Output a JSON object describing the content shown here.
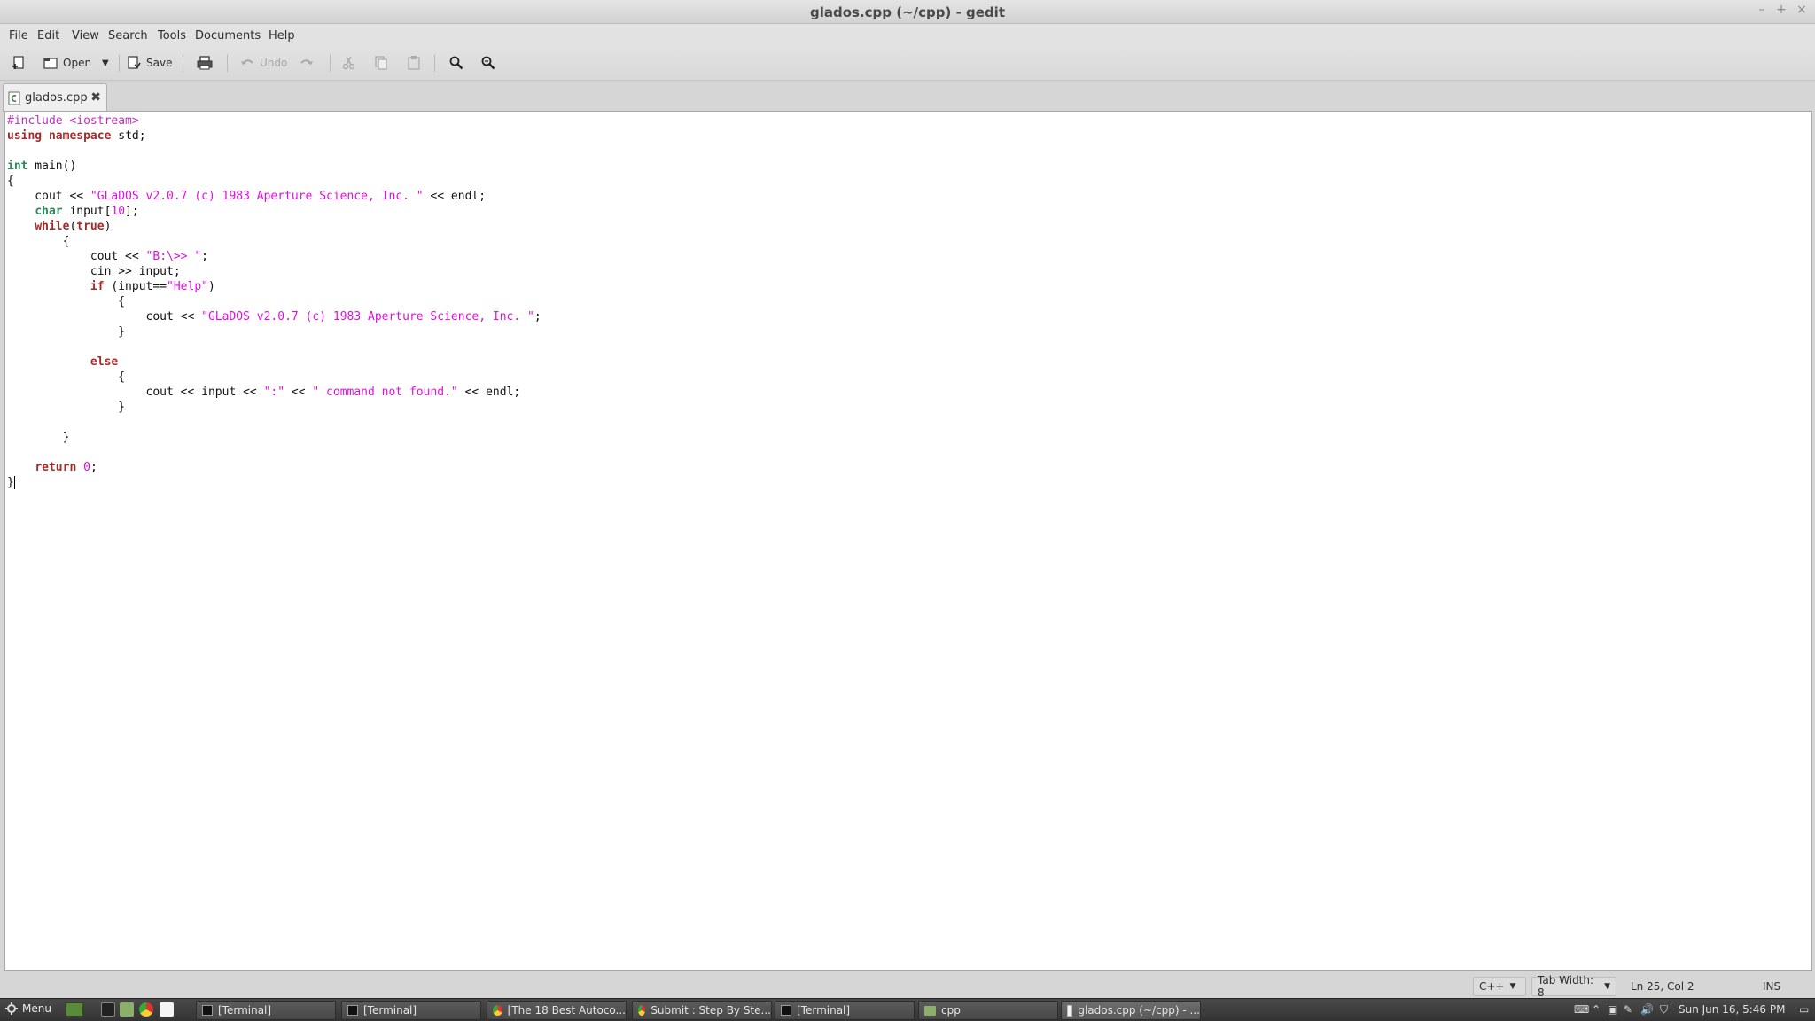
{
  "window": {
    "title": "glados.cpp (~/cpp) - gedit",
    "controls": [
      "–",
      "+",
      "×"
    ]
  },
  "menubar": [
    "File",
    "Edit",
    "View",
    "Search",
    "Tools",
    "Documents",
    "Help"
  ],
  "toolbar": {
    "open_label": "Open",
    "save_label": "Save",
    "undo_label": "Undo",
    "dropdown_glyph": "▼"
  },
  "tab": {
    "label": "glados.cpp",
    "close_glyph": "✖"
  },
  "editor": {
    "lines": [
      [
        {
          "t": "#include <iostream>",
          "c": "pp"
        }
      ],
      [
        {
          "t": "using",
          "c": "kw"
        },
        {
          "t": " "
        },
        {
          "t": "namespace",
          "c": "kw"
        },
        {
          "t": " std;"
        }
      ],
      [],
      [
        {
          "t": "int",
          "c": "ty"
        },
        {
          "t": " main()"
        }
      ],
      [
        {
          "t": "{"
        }
      ],
      [
        {
          "t": "    cout << "
        },
        {
          "t": "\"GLaDOS v2.0.7 (c) 1983 Aperture Science, Inc. \"",
          "c": "st"
        },
        {
          "t": " << endl;"
        }
      ],
      [
        {
          "t": "    "
        },
        {
          "t": "char",
          "c": "ty"
        },
        {
          "t": " input["
        },
        {
          "t": "10",
          "c": "nu"
        },
        {
          "t": "];"
        }
      ],
      [
        {
          "t": "    "
        },
        {
          "t": "while",
          "c": "kw"
        },
        {
          "t": "("
        },
        {
          "t": "true",
          "c": "kw"
        },
        {
          "t": ")"
        }
      ],
      [
        {
          "t": "        {"
        }
      ],
      [
        {
          "t": "            cout << "
        },
        {
          "t": "\"B:\\>> \"",
          "c": "st"
        },
        {
          "t": ";"
        }
      ],
      [
        {
          "t": "            cin >> input;"
        }
      ],
      [
        {
          "t": "            "
        },
        {
          "t": "if",
          "c": "kw"
        },
        {
          "t": " (input=="
        },
        {
          "t": "\"Help\"",
          "c": "st"
        },
        {
          "t": ")"
        }
      ],
      [
        {
          "t": "                {"
        }
      ],
      [
        {
          "t": "                    cout << "
        },
        {
          "t": "\"GLaDOS v2.0.7 (c) 1983 Aperture Science, Inc. \"",
          "c": "st"
        },
        {
          "t": ";"
        }
      ],
      [
        {
          "t": "                }"
        }
      ],
      [],
      [
        {
          "t": "            "
        },
        {
          "t": "else",
          "c": "kw"
        }
      ],
      [
        {
          "t": "                {"
        }
      ],
      [
        {
          "t": "                    cout << input << "
        },
        {
          "t": "\":\"",
          "c": "st"
        },
        {
          "t": " << "
        },
        {
          "t": "\" command not found.\"",
          "c": "st"
        },
        {
          "t": " << endl;"
        }
      ],
      [
        {
          "t": "                }"
        }
      ],
      [],
      [
        {
          "t": "        }"
        }
      ],
      [],
      [
        {
          "t": "    "
        },
        {
          "t": "return",
          "c": "kw"
        },
        {
          "t": " "
        },
        {
          "t": "0",
          "c": "nu"
        },
        {
          "t": ";"
        }
      ],
      [
        {
          "t": "}"
        }
      ]
    ]
  },
  "statusbar": {
    "language": "C++",
    "tab_width": "Tab Width: 8",
    "position": "Ln 25, Col 2",
    "mode": "INS",
    "dropdown_glyph": "▼"
  },
  "taskbar": {
    "menu_label": "Menu",
    "tasks": [
      {
        "label": "[Terminal]",
        "icon": "terminal-icon"
      },
      {
        "label": "[Terminal]",
        "icon": "terminal-icon"
      },
      {
        "label": "[The 18 Best Autoco...",
        "icon": "chrome-icon"
      },
      {
        "label": "Submit : Step By Ste...",
        "icon": "chrome-icon"
      },
      {
        "label": "[Terminal]",
        "icon": "terminal-icon"
      },
      {
        "label": "cpp",
        "icon": "folder-icon"
      },
      {
        "label": "glados.cpp (~/cpp) - ...",
        "icon": "text-editor-icon"
      }
    ],
    "clock": "Sun Jun 16,  5:46 PM"
  },
  "colors": {
    "preprocessor": "#c12ec1",
    "keyword": "#a52a2a",
    "type": "#2e8b57",
    "string": "#e010e0"
  }
}
